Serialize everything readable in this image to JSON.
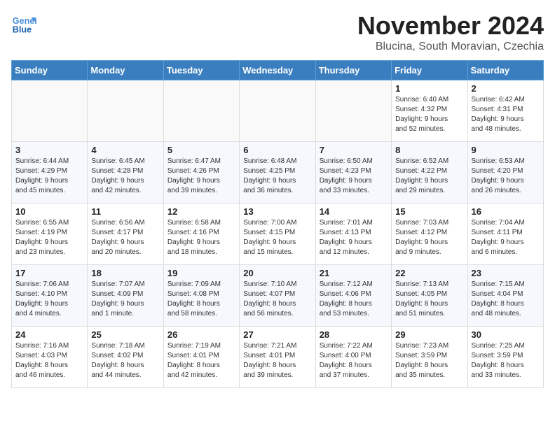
{
  "header": {
    "logo_line1": "General",
    "logo_line2": "Blue",
    "month_title": "November 2024",
    "location": "Blucina, South Moravian, Czechia"
  },
  "weekdays": [
    "Sunday",
    "Monday",
    "Tuesday",
    "Wednesday",
    "Thursday",
    "Friday",
    "Saturday"
  ],
  "weeks": [
    [
      {
        "day": "",
        "info": "",
        "empty": true
      },
      {
        "day": "",
        "info": "",
        "empty": true
      },
      {
        "day": "",
        "info": "",
        "empty": true
      },
      {
        "day": "",
        "info": "",
        "empty": true
      },
      {
        "day": "",
        "info": "",
        "empty": true
      },
      {
        "day": "1",
        "info": "Sunrise: 6:40 AM\nSunset: 4:32 PM\nDaylight: 9 hours\nand 52 minutes."
      },
      {
        "day": "2",
        "info": "Sunrise: 6:42 AM\nSunset: 4:31 PM\nDaylight: 9 hours\nand 48 minutes."
      }
    ],
    [
      {
        "day": "3",
        "info": "Sunrise: 6:44 AM\nSunset: 4:29 PM\nDaylight: 9 hours\nand 45 minutes."
      },
      {
        "day": "4",
        "info": "Sunrise: 6:45 AM\nSunset: 4:28 PM\nDaylight: 9 hours\nand 42 minutes."
      },
      {
        "day": "5",
        "info": "Sunrise: 6:47 AM\nSunset: 4:26 PM\nDaylight: 9 hours\nand 39 minutes."
      },
      {
        "day": "6",
        "info": "Sunrise: 6:48 AM\nSunset: 4:25 PM\nDaylight: 9 hours\nand 36 minutes."
      },
      {
        "day": "7",
        "info": "Sunrise: 6:50 AM\nSunset: 4:23 PM\nDaylight: 9 hours\nand 33 minutes."
      },
      {
        "day": "8",
        "info": "Sunrise: 6:52 AM\nSunset: 4:22 PM\nDaylight: 9 hours\nand 29 minutes."
      },
      {
        "day": "9",
        "info": "Sunrise: 6:53 AM\nSunset: 4:20 PM\nDaylight: 9 hours\nand 26 minutes."
      }
    ],
    [
      {
        "day": "10",
        "info": "Sunrise: 6:55 AM\nSunset: 4:19 PM\nDaylight: 9 hours\nand 23 minutes."
      },
      {
        "day": "11",
        "info": "Sunrise: 6:56 AM\nSunset: 4:17 PM\nDaylight: 9 hours\nand 20 minutes."
      },
      {
        "day": "12",
        "info": "Sunrise: 6:58 AM\nSunset: 4:16 PM\nDaylight: 9 hours\nand 18 minutes."
      },
      {
        "day": "13",
        "info": "Sunrise: 7:00 AM\nSunset: 4:15 PM\nDaylight: 9 hours\nand 15 minutes."
      },
      {
        "day": "14",
        "info": "Sunrise: 7:01 AM\nSunset: 4:13 PM\nDaylight: 9 hours\nand 12 minutes."
      },
      {
        "day": "15",
        "info": "Sunrise: 7:03 AM\nSunset: 4:12 PM\nDaylight: 9 hours\nand 9 minutes."
      },
      {
        "day": "16",
        "info": "Sunrise: 7:04 AM\nSunset: 4:11 PM\nDaylight: 9 hours\nand 6 minutes."
      }
    ],
    [
      {
        "day": "17",
        "info": "Sunrise: 7:06 AM\nSunset: 4:10 PM\nDaylight: 9 hours\nand 4 minutes."
      },
      {
        "day": "18",
        "info": "Sunrise: 7:07 AM\nSunset: 4:09 PM\nDaylight: 9 hours\nand 1 minute."
      },
      {
        "day": "19",
        "info": "Sunrise: 7:09 AM\nSunset: 4:08 PM\nDaylight: 8 hours\nand 58 minutes."
      },
      {
        "day": "20",
        "info": "Sunrise: 7:10 AM\nSunset: 4:07 PM\nDaylight: 8 hours\nand 56 minutes."
      },
      {
        "day": "21",
        "info": "Sunrise: 7:12 AM\nSunset: 4:06 PM\nDaylight: 8 hours\nand 53 minutes."
      },
      {
        "day": "22",
        "info": "Sunrise: 7:13 AM\nSunset: 4:05 PM\nDaylight: 8 hours\nand 51 minutes."
      },
      {
        "day": "23",
        "info": "Sunrise: 7:15 AM\nSunset: 4:04 PM\nDaylight: 8 hours\nand 48 minutes."
      }
    ],
    [
      {
        "day": "24",
        "info": "Sunrise: 7:16 AM\nSunset: 4:03 PM\nDaylight: 8 hours\nand 46 minutes."
      },
      {
        "day": "25",
        "info": "Sunrise: 7:18 AM\nSunset: 4:02 PM\nDaylight: 8 hours\nand 44 minutes."
      },
      {
        "day": "26",
        "info": "Sunrise: 7:19 AM\nSunset: 4:01 PM\nDaylight: 8 hours\nand 42 minutes."
      },
      {
        "day": "27",
        "info": "Sunrise: 7:21 AM\nSunset: 4:01 PM\nDaylight: 8 hours\nand 39 minutes."
      },
      {
        "day": "28",
        "info": "Sunrise: 7:22 AM\nSunset: 4:00 PM\nDaylight: 8 hours\nand 37 minutes."
      },
      {
        "day": "29",
        "info": "Sunrise: 7:23 AM\nSunset: 3:59 PM\nDaylight: 8 hours\nand 35 minutes."
      },
      {
        "day": "30",
        "info": "Sunrise: 7:25 AM\nSunset: 3:59 PM\nDaylight: 8 hours\nand 33 minutes."
      }
    ]
  ]
}
